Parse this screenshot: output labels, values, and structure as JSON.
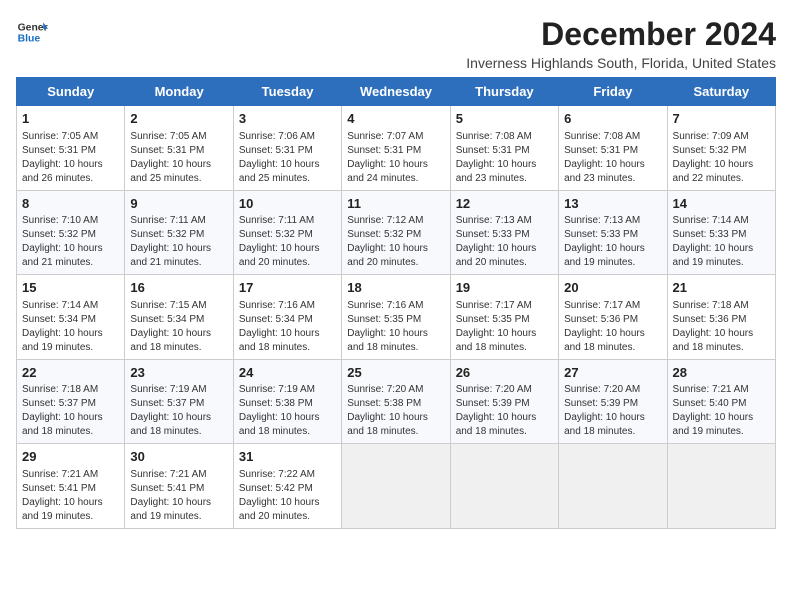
{
  "header": {
    "logo_line1": "General",
    "logo_line2": "Blue",
    "title": "December 2024",
    "subtitle": "Inverness Highlands South, Florida, United States"
  },
  "weekdays": [
    "Sunday",
    "Monday",
    "Tuesday",
    "Wednesday",
    "Thursday",
    "Friday",
    "Saturday"
  ],
  "weeks": [
    [
      {
        "day": "1",
        "sunrise": "Sunrise: 7:05 AM",
        "sunset": "Sunset: 5:31 PM",
        "daylight": "Daylight: 10 hours and 26 minutes."
      },
      {
        "day": "2",
        "sunrise": "Sunrise: 7:05 AM",
        "sunset": "Sunset: 5:31 PM",
        "daylight": "Daylight: 10 hours and 25 minutes."
      },
      {
        "day": "3",
        "sunrise": "Sunrise: 7:06 AM",
        "sunset": "Sunset: 5:31 PM",
        "daylight": "Daylight: 10 hours and 25 minutes."
      },
      {
        "day": "4",
        "sunrise": "Sunrise: 7:07 AM",
        "sunset": "Sunset: 5:31 PM",
        "daylight": "Daylight: 10 hours and 24 minutes."
      },
      {
        "day": "5",
        "sunrise": "Sunrise: 7:08 AM",
        "sunset": "Sunset: 5:31 PM",
        "daylight": "Daylight: 10 hours and 23 minutes."
      },
      {
        "day": "6",
        "sunrise": "Sunrise: 7:08 AM",
        "sunset": "Sunset: 5:31 PM",
        "daylight": "Daylight: 10 hours and 23 minutes."
      },
      {
        "day": "7",
        "sunrise": "Sunrise: 7:09 AM",
        "sunset": "Sunset: 5:32 PM",
        "daylight": "Daylight: 10 hours and 22 minutes."
      }
    ],
    [
      {
        "day": "8",
        "sunrise": "Sunrise: 7:10 AM",
        "sunset": "Sunset: 5:32 PM",
        "daylight": "Daylight: 10 hours and 21 minutes."
      },
      {
        "day": "9",
        "sunrise": "Sunrise: 7:11 AM",
        "sunset": "Sunset: 5:32 PM",
        "daylight": "Daylight: 10 hours and 21 minutes."
      },
      {
        "day": "10",
        "sunrise": "Sunrise: 7:11 AM",
        "sunset": "Sunset: 5:32 PM",
        "daylight": "Daylight: 10 hours and 20 minutes."
      },
      {
        "day": "11",
        "sunrise": "Sunrise: 7:12 AM",
        "sunset": "Sunset: 5:32 PM",
        "daylight": "Daylight: 10 hours and 20 minutes."
      },
      {
        "day": "12",
        "sunrise": "Sunrise: 7:13 AM",
        "sunset": "Sunset: 5:33 PM",
        "daylight": "Daylight: 10 hours and 20 minutes."
      },
      {
        "day": "13",
        "sunrise": "Sunrise: 7:13 AM",
        "sunset": "Sunset: 5:33 PM",
        "daylight": "Daylight: 10 hours and 19 minutes."
      },
      {
        "day": "14",
        "sunrise": "Sunrise: 7:14 AM",
        "sunset": "Sunset: 5:33 PM",
        "daylight": "Daylight: 10 hours and 19 minutes."
      }
    ],
    [
      {
        "day": "15",
        "sunrise": "Sunrise: 7:14 AM",
        "sunset": "Sunset: 5:34 PM",
        "daylight": "Daylight: 10 hours and 19 minutes."
      },
      {
        "day": "16",
        "sunrise": "Sunrise: 7:15 AM",
        "sunset": "Sunset: 5:34 PM",
        "daylight": "Daylight: 10 hours and 18 minutes."
      },
      {
        "day": "17",
        "sunrise": "Sunrise: 7:16 AM",
        "sunset": "Sunset: 5:34 PM",
        "daylight": "Daylight: 10 hours and 18 minutes."
      },
      {
        "day": "18",
        "sunrise": "Sunrise: 7:16 AM",
        "sunset": "Sunset: 5:35 PM",
        "daylight": "Daylight: 10 hours and 18 minutes."
      },
      {
        "day": "19",
        "sunrise": "Sunrise: 7:17 AM",
        "sunset": "Sunset: 5:35 PM",
        "daylight": "Daylight: 10 hours and 18 minutes."
      },
      {
        "day": "20",
        "sunrise": "Sunrise: 7:17 AM",
        "sunset": "Sunset: 5:36 PM",
        "daylight": "Daylight: 10 hours and 18 minutes."
      },
      {
        "day": "21",
        "sunrise": "Sunrise: 7:18 AM",
        "sunset": "Sunset: 5:36 PM",
        "daylight": "Daylight: 10 hours and 18 minutes."
      }
    ],
    [
      {
        "day": "22",
        "sunrise": "Sunrise: 7:18 AM",
        "sunset": "Sunset: 5:37 PM",
        "daylight": "Daylight: 10 hours and 18 minutes."
      },
      {
        "day": "23",
        "sunrise": "Sunrise: 7:19 AM",
        "sunset": "Sunset: 5:37 PM",
        "daylight": "Daylight: 10 hours and 18 minutes."
      },
      {
        "day": "24",
        "sunrise": "Sunrise: 7:19 AM",
        "sunset": "Sunset: 5:38 PM",
        "daylight": "Daylight: 10 hours and 18 minutes."
      },
      {
        "day": "25",
        "sunrise": "Sunrise: 7:20 AM",
        "sunset": "Sunset: 5:38 PM",
        "daylight": "Daylight: 10 hours and 18 minutes."
      },
      {
        "day": "26",
        "sunrise": "Sunrise: 7:20 AM",
        "sunset": "Sunset: 5:39 PM",
        "daylight": "Daylight: 10 hours and 18 minutes."
      },
      {
        "day": "27",
        "sunrise": "Sunrise: 7:20 AM",
        "sunset": "Sunset: 5:39 PM",
        "daylight": "Daylight: 10 hours and 18 minutes."
      },
      {
        "day": "28",
        "sunrise": "Sunrise: 7:21 AM",
        "sunset": "Sunset: 5:40 PM",
        "daylight": "Daylight: 10 hours and 19 minutes."
      }
    ],
    [
      {
        "day": "29",
        "sunrise": "Sunrise: 7:21 AM",
        "sunset": "Sunset: 5:41 PM",
        "daylight": "Daylight: 10 hours and 19 minutes."
      },
      {
        "day": "30",
        "sunrise": "Sunrise: 7:21 AM",
        "sunset": "Sunset: 5:41 PM",
        "daylight": "Daylight: 10 hours and 19 minutes."
      },
      {
        "day": "31",
        "sunrise": "Sunrise: 7:22 AM",
        "sunset": "Sunset: 5:42 PM",
        "daylight": "Daylight: 10 hours and 20 minutes."
      },
      null,
      null,
      null,
      null
    ]
  ]
}
